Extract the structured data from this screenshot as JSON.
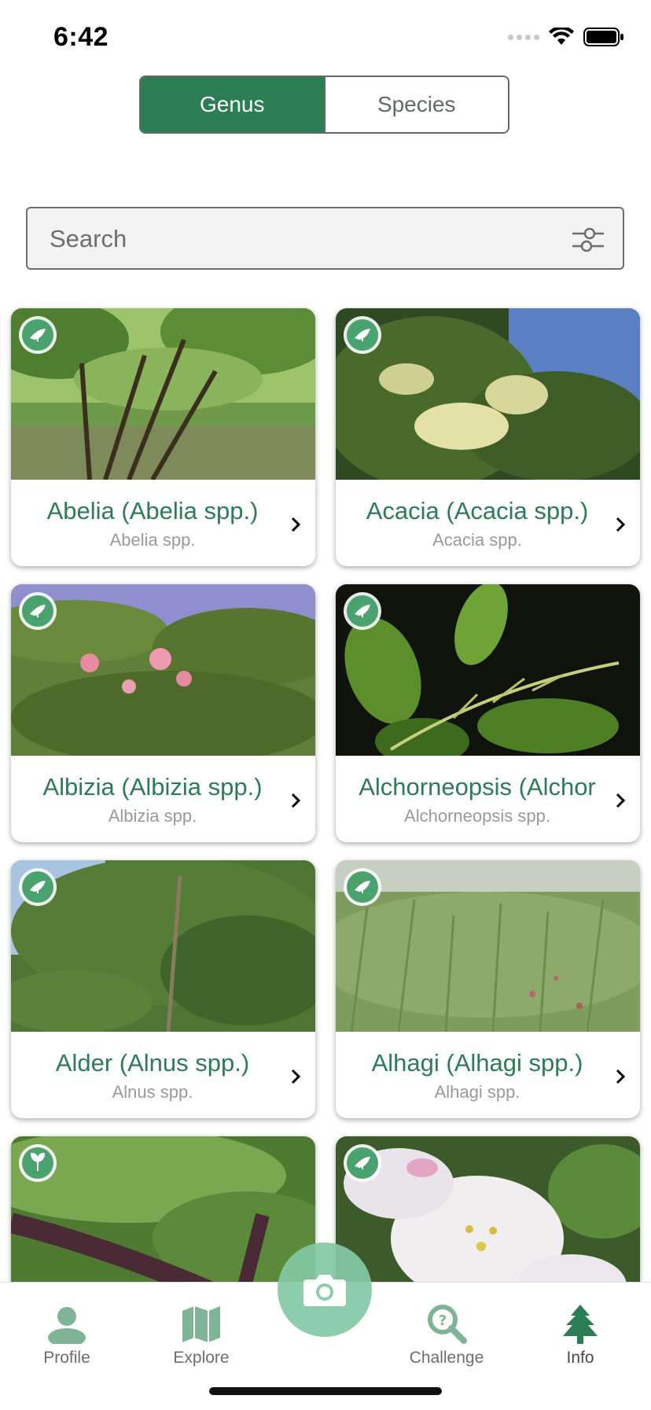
{
  "status": {
    "time": "6:42"
  },
  "segmented": {
    "genus_label": "Genus",
    "species_label": "Species"
  },
  "search": {
    "placeholder": "Search"
  },
  "cards": [
    {
      "title": "Abelia (Abelia spp.)",
      "subtitle": "Abelia spp."
    },
    {
      "title": "Acacia (Acacia spp.)",
      "subtitle": "Acacia spp."
    },
    {
      "title": "Albizia (Albizia spp.)",
      "subtitle": "Albizia spp."
    },
    {
      "title": "Alchorneopsis (Alchor",
      "subtitle": "Alchorneopsis spp."
    },
    {
      "title": "Alder (Alnus spp.)",
      "subtitle": "Alnus spp."
    },
    {
      "title": "Alhagi (Alhagi spp.)",
      "subtitle": "Alhagi spp."
    },
    {
      "title": "",
      "subtitle": ""
    },
    {
      "title": "",
      "subtitle": ""
    }
  ],
  "tabs": {
    "profile": "Profile",
    "explore": "Explore",
    "challenge": "Challenge",
    "info": "Info"
  },
  "colors": {
    "accent": "#2b7d53",
    "fab": "#84c9a5",
    "subtitle": "#9a9a9a"
  }
}
